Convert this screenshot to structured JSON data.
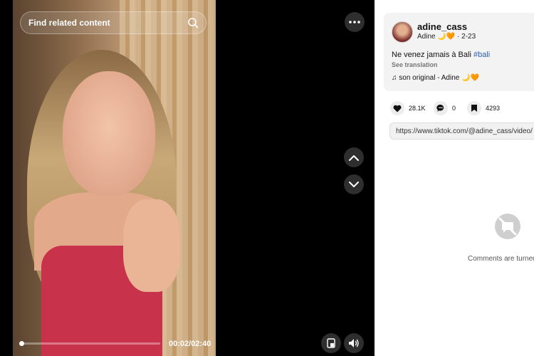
{
  "player": {
    "search_placeholder": "Find related content",
    "time": "00:02/02:40",
    "progress": 0.013
  },
  "post": {
    "username": "adine_cass",
    "display_name": "Adine 🌙🧡",
    "date": "· 2-23",
    "caption": "Ne venez jamais à Bali ",
    "hashtag": "#bali",
    "see_translation": "See translation",
    "music": "son original - Adine 🌙🧡"
  },
  "stats": {
    "likes": "28.1K",
    "comments": "0",
    "saves": "4293"
  },
  "link": "https://www.tiktok.com/@adine_cass/video/",
  "comments_off_text": "Comments are turned"
}
